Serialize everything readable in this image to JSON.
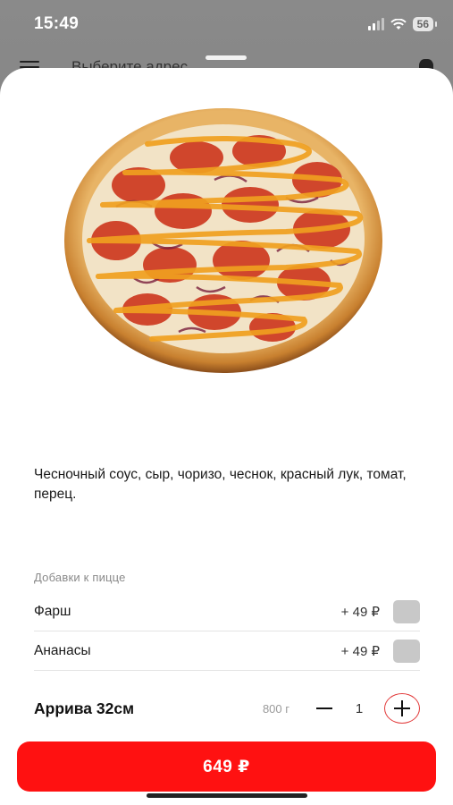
{
  "status_bar": {
    "time": "15:49",
    "battery": "56"
  },
  "background_header": {
    "title": "Выберите адрес"
  },
  "product": {
    "description": "Чесночный соус, сыр, чоризо, чеснок, красный лук, томат, перец.",
    "name": "Аррива 32см",
    "weight": "800 г",
    "quantity": "1"
  },
  "addons": {
    "title": "Добавки к пицце",
    "items": [
      {
        "name": "Фарш",
        "price": "+ 49 ₽"
      },
      {
        "name": "Ананасы",
        "price": "+ 49 ₽"
      }
    ]
  },
  "order_button": {
    "label": "649 ₽"
  },
  "colors": {
    "accent": "#ff1111",
    "checkbox": "#c8c8c8"
  },
  "icons": [
    "menu-icon",
    "cart-icon",
    "wifi-icon",
    "signal-icon",
    "battery-icon",
    "minus-icon",
    "plus-icon"
  ]
}
